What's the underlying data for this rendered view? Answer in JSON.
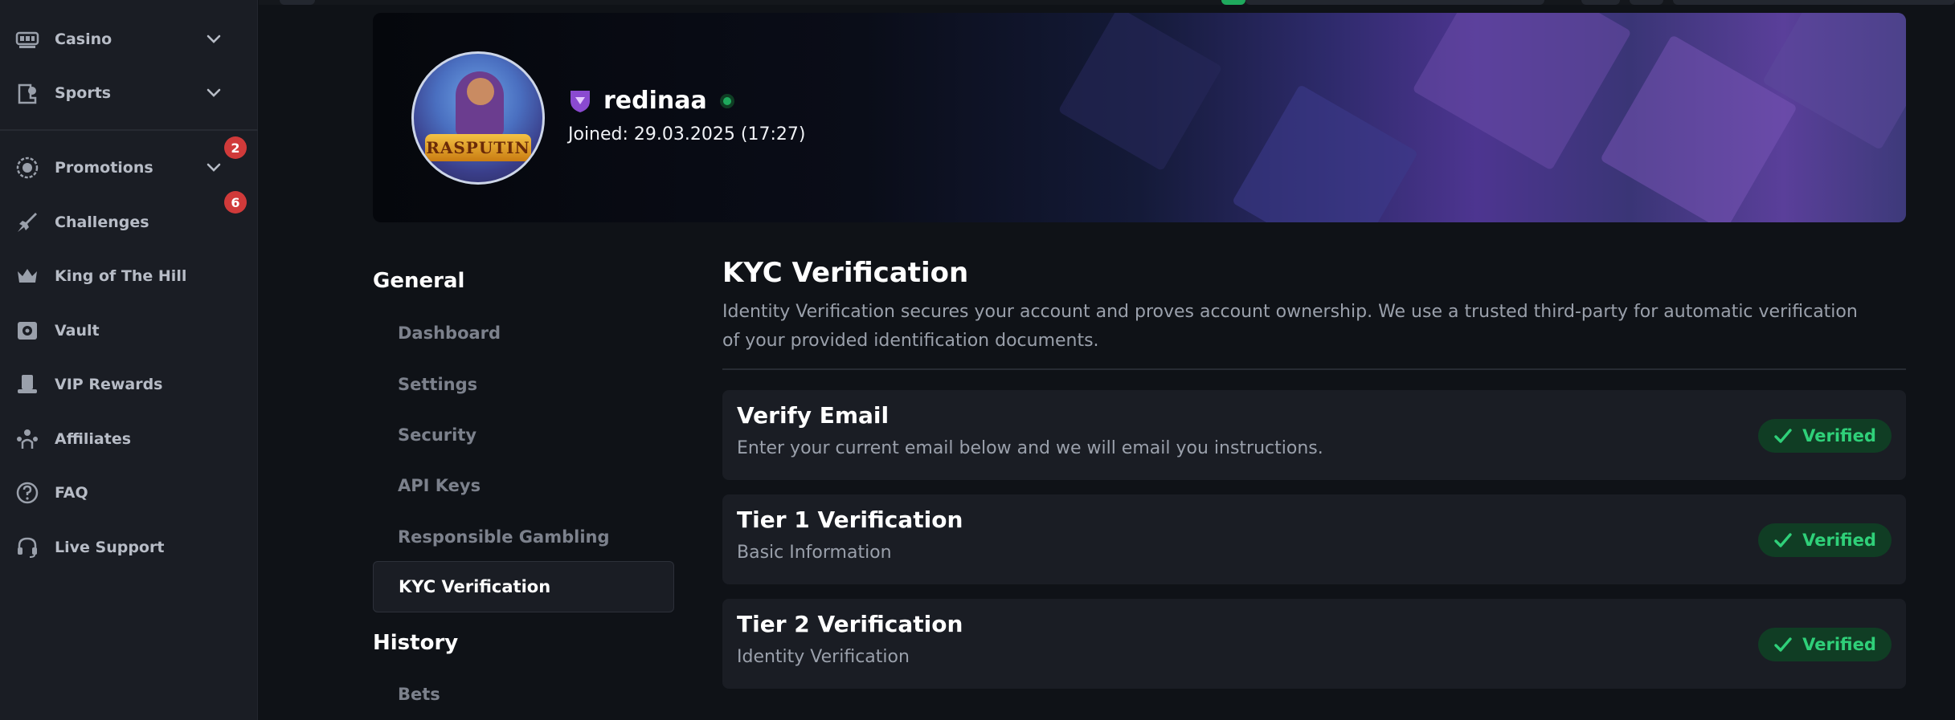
{
  "sidebar": {
    "items": [
      {
        "label": "Casino",
        "icon": "casino-icon"
      },
      {
        "label": "Sports",
        "icon": "sports-icon"
      },
      {
        "label": "Promotions",
        "icon": "promotions-icon",
        "badge": "2"
      },
      {
        "label": "Challenges",
        "icon": "challenges-icon",
        "badge": "6"
      },
      {
        "label": "King of The Hill",
        "icon": "crown-icon"
      },
      {
        "label": "Vault",
        "icon": "vault-icon"
      },
      {
        "label": "VIP Rewards",
        "icon": "vip-hat-icon"
      },
      {
        "label": "Affiliates",
        "icon": "affiliates-icon"
      },
      {
        "label": "FAQ",
        "icon": "question-icon"
      },
      {
        "label": "Live Support",
        "icon": "headset-icon"
      }
    ]
  },
  "profile": {
    "username": "redinaa",
    "joined": "Joined: 29.03.2025 (17:27)",
    "avatar_logo": "RASPUTIN",
    "status": "online"
  },
  "menu": {
    "general_heading": "General",
    "items": [
      "Dashboard",
      "Settings",
      "Security",
      "API Keys",
      "Responsible Gambling",
      "KYC Verification"
    ],
    "active": "KYC Verification",
    "history_heading": "History",
    "history_items": [
      "Bets"
    ]
  },
  "kyc": {
    "title": "KYC Verification",
    "description": "Identity Verification secures your account and proves account ownership. We use a trusted third-party for automatic verification of your provided identification documents.",
    "cards": [
      {
        "title": "Verify Email",
        "subtitle": "Enter your current email below and we will email you instructions.",
        "status": "Verified"
      },
      {
        "title": "Tier 1 Verification",
        "subtitle": "Basic Information",
        "status": "Verified"
      },
      {
        "title": "Tier 2 Verification",
        "subtitle": "Identity Verification",
        "status": "Verified"
      }
    ]
  },
  "colors": {
    "accent_green": "#2fd079",
    "badge_red": "#d03a3a",
    "background": "#0f1217",
    "panel": "#1a1d24"
  }
}
